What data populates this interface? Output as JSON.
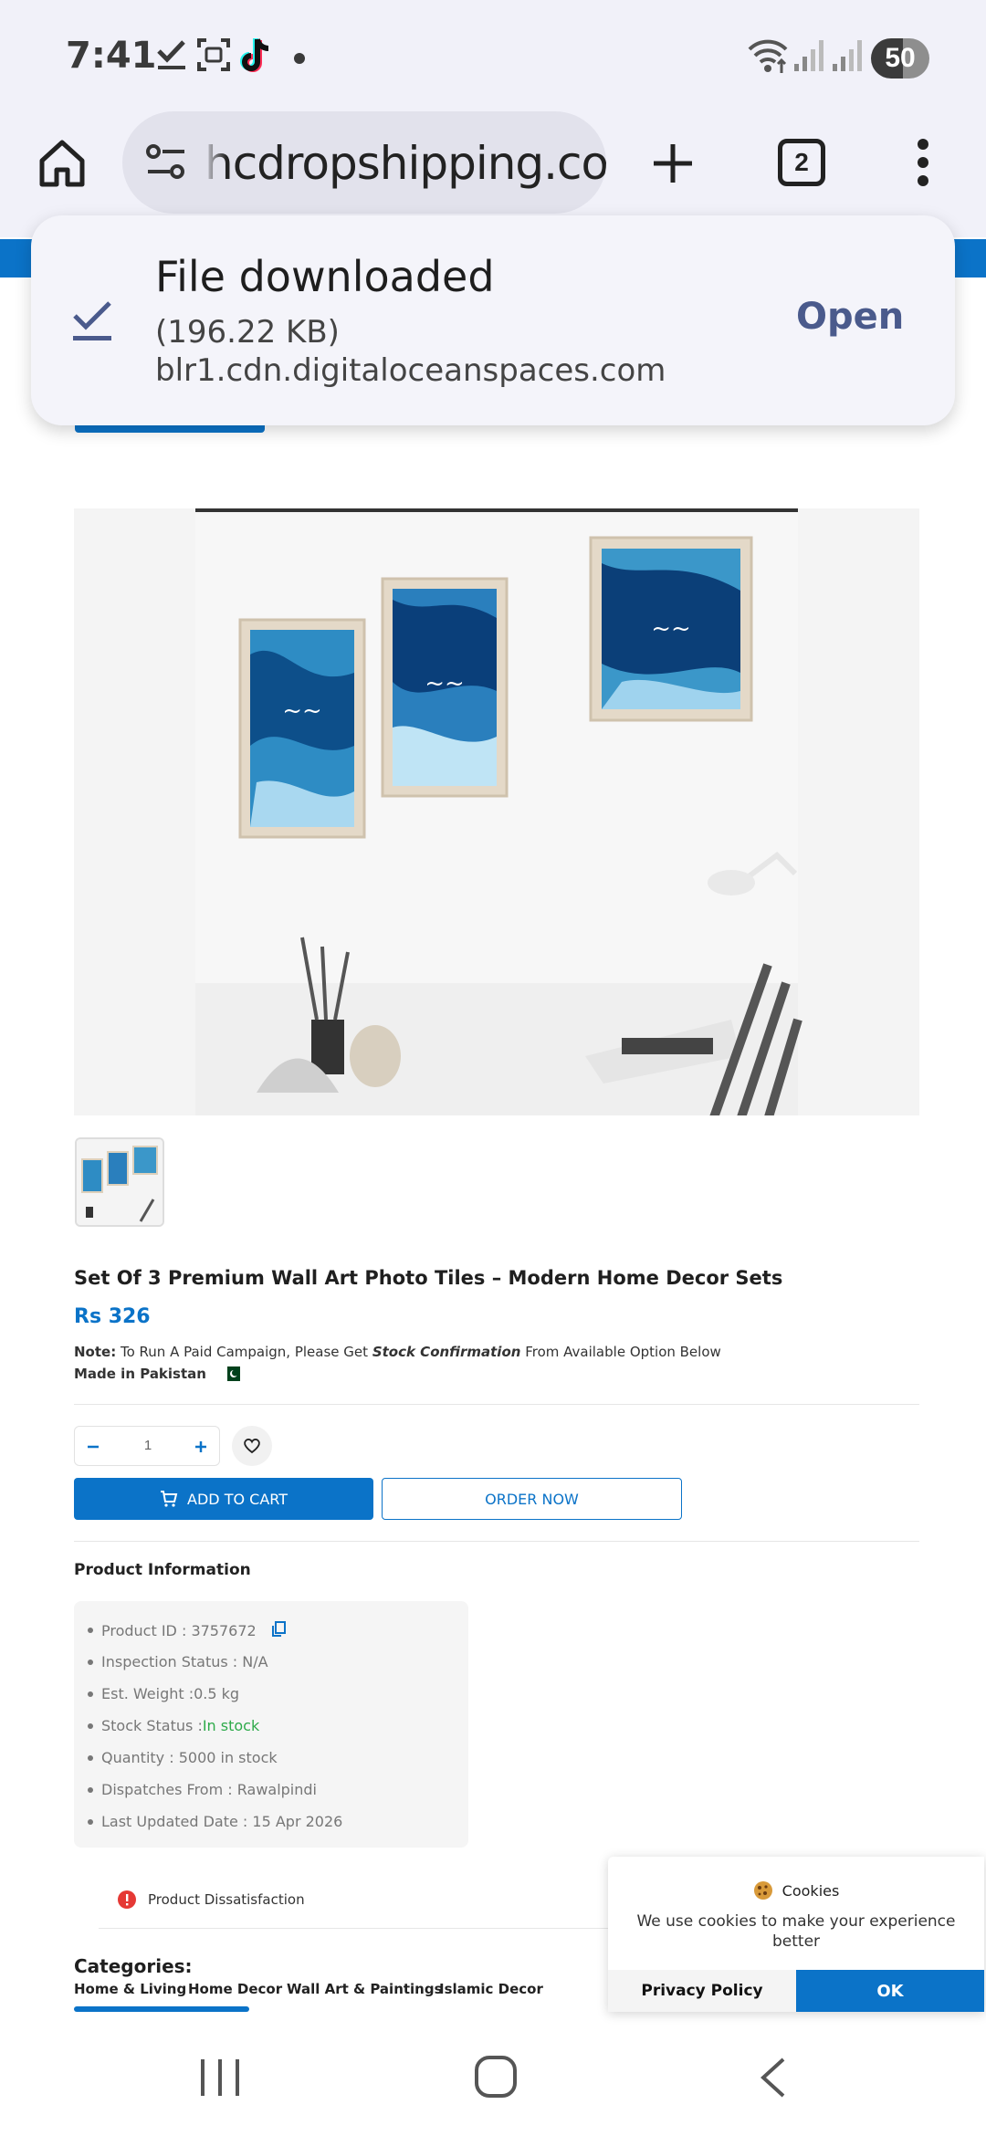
{
  "status_bar": {
    "time": "7:41",
    "battery": "50"
  },
  "browser": {
    "url": "hcdropshipping.com",
    "tab_count": "2"
  },
  "download_toast": {
    "title": "File downloaded",
    "size": "(196.22 KB)",
    "host": "blr1.cdn.digitaloceanspaces.com",
    "open_label": "Open"
  },
  "product": {
    "title": "Set Of 3 Premium Wall Art Photo Tiles – Modern Home Decor Sets",
    "price": "Rs 326",
    "note_label": "Note:",
    "note_text_1": "To Run A Paid Campaign, Please Get",
    "note_emphasis": "Stock Confirmation",
    "note_text_2": "From Available Option Below",
    "made_in": "Made in Pakistan",
    "quantity": "1",
    "add_to_cart": "ADD TO CART",
    "order_now": "ORDER NOW"
  },
  "product_info": {
    "heading": "Product Information",
    "product_id": "Product ID : 3757672",
    "inspection": "Inspection Status : N/A",
    "weight": "Est. Weight :0.5 kg",
    "stock_label": "Stock Status :",
    "stock_value": "In stock",
    "quantity": "Quantity : 5000 in stock",
    "dispatch": "Dispatches From : Rawalpindi",
    "updated": "Last Updated Date : 15 Apr 2026"
  },
  "dissatisfaction": "Product Dissatisfaction",
  "categories": {
    "heading": "Categories:",
    "items": [
      "Home & Living",
      "Home Decor",
      "Wall Art & Paintings",
      "Islamic Decor"
    ]
  },
  "cookie_banner": {
    "title": "Cookies",
    "message": "We use cookies to make your experience better",
    "privacy_label": "Privacy Policy",
    "ok_label": "OK"
  },
  "colors": {
    "accent": "#0b73c8",
    "in_stock": "#2eaa4a",
    "toast_open": "#4a5a8c"
  },
  "icons": [
    "home-icon",
    "site-settings-icon",
    "new-tab-icon",
    "tab-switcher-icon",
    "overflow-menu-icon",
    "download-check-icon",
    "cart-icon",
    "heart-icon",
    "copy-icon",
    "alert-icon",
    "cookie-icon",
    "recents-icon",
    "home-nav-icon",
    "back-icon"
  ]
}
